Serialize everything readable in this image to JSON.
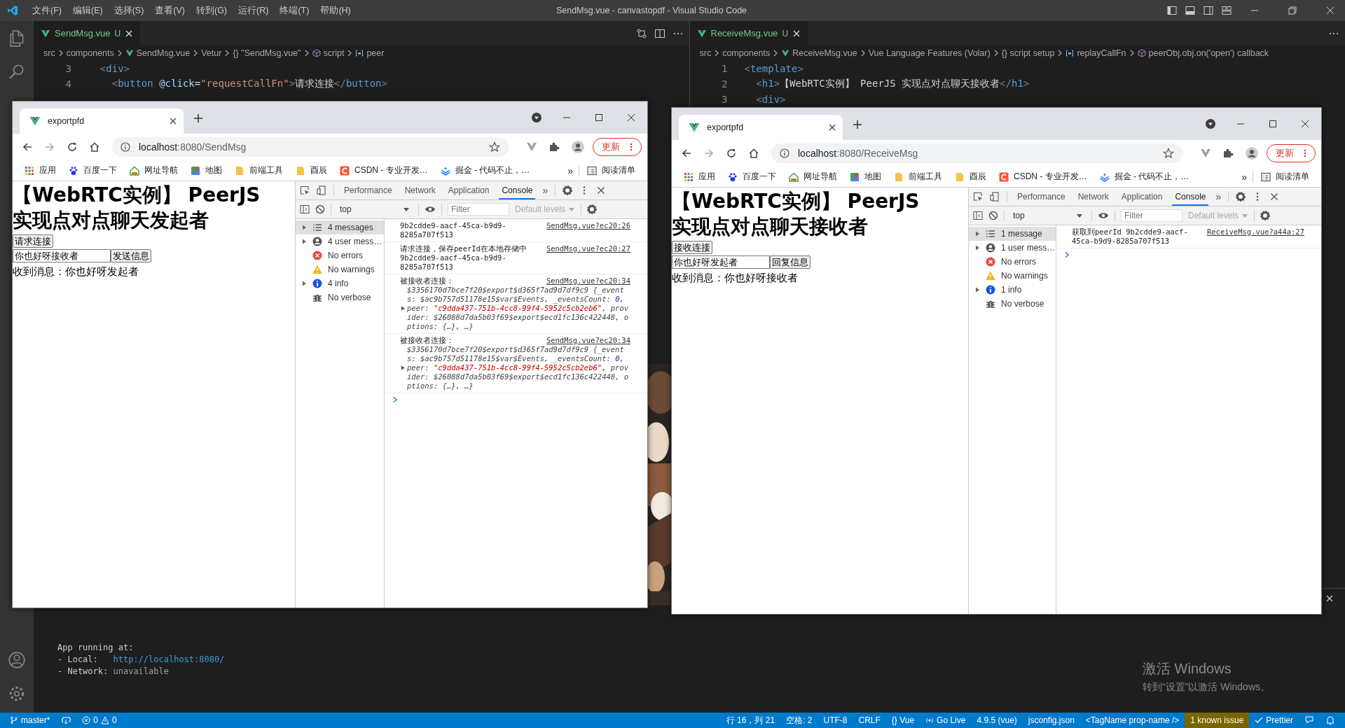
{
  "vscode": {
    "menu": [
      "文件(F)",
      "编辑(E)",
      "选择(S)",
      "查看(V)",
      "转到(G)",
      "运行(R)",
      "终端(T)",
      "帮助(H)"
    ],
    "title": "SendMsg.vue - canvastopdf - Visual Studio Code",
    "editors": [
      {
        "tab": {
          "label": "SendMsg.vue",
          "status": "U",
          "selected": true
        },
        "breadcrumbs": [
          {
            "kind": "text",
            "label": "src"
          },
          {
            "kind": "text",
            "label": "components"
          },
          {
            "kind": "vue",
            "label": "SendMsg.vue"
          },
          {
            "kind": "text",
            "label": "Vetur"
          },
          {
            "kind": "text",
            "label": "{} \"SendMsg.vue\""
          },
          {
            "kind": "cube",
            "label": "script"
          },
          {
            "kind": "var",
            "label": "peer"
          }
        ],
        "lines": [
          {
            "number": "3",
            "tokens": [
              {
                "kind": "bracket",
                "text": "  <"
              },
              {
                "kind": "tag",
                "text": "div"
              },
              {
                "kind": "bracket",
                "text": ">"
              }
            ]
          },
          {
            "number": "4",
            "tokens": [
              {
                "kind": "bracket",
                "text": "    <"
              },
              {
                "kind": "tag",
                "text": "button"
              },
              {
                "kind": "attr",
                "text": " @click"
              },
              {
                "kind": "text",
                "text": "="
              },
              {
                "kind": "string",
                "text": "\"requestCallFn\""
              },
              {
                "kind": "bracket",
                "text": ">"
              },
              {
                "kind": "text",
                "text": "请求连接"
              },
              {
                "kind": "bracket",
                "text": "</"
              },
              {
                "kind": "tag",
                "text": "button"
              },
              {
                "kind": "bracket",
                "text": ">"
              }
            ]
          }
        ]
      },
      {
        "tab": {
          "label": "ReceiveMsg.vue",
          "status": "U",
          "selected": true
        },
        "breadcrumbs": [
          {
            "kind": "text",
            "label": "src"
          },
          {
            "kind": "text",
            "label": "components"
          },
          {
            "kind": "vue",
            "label": "ReceiveMsg.vue"
          },
          {
            "kind": "text",
            "label": "Vue Language Features (Volar)"
          },
          {
            "kind": "text",
            "label": "{} script setup"
          },
          {
            "kind": "var",
            "label": "replayCallFn"
          },
          {
            "kind": "cube",
            "label": "peerObj.obj.on('open') callback"
          }
        ],
        "lines": [
          {
            "number": "1",
            "tokens": [
              {
                "kind": "bracket",
                "text": "<"
              },
              {
                "kind": "tag",
                "text": "template"
              },
              {
                "kind": "bracket",
                "text": ">"
              }
            ]
          },
          {
            "number": "2",
            "tokens": [
              {
                "kind": "bracket",
                "text": "  <"
              },
              {
                "kind": "tag",
                "text": "h1"
              },
              {
                "kind": "bracket",
                "text": ">"
              },
              {
                "kind": "text",
                "text": "【WebRTC实例】 PeerJS 实现点对点聊天接收者"
              },
              {
                "kind": "bracket",
                "text": "</"
              },
              {
                "kind": "tag",
                "text": "h1"
              },
              {
                "kind": "bracket",
                "text": ">"
              }
            ]
          },
          {
            "number": "3",
            "tokens": [
              {
                "kind": "bracket",
                "text": "  <"
              },
              {
                "kind": "tag",
                "text": "div"
              },
              {
                "kind": "bracket",
                "text": ">"
              }
            ]
          }
        ]
      }
    ],
    "terminal": [
      [
        {
          "kind": "plain",
          "text": "App running at:"
        }
      ],
      [
        {
          "kind": "plain",
          "text": "- Local:   "
        },
        {
          "kind": "link",
          "text": "http://localhost:8080/"
        }
      ],
      [
        {
          "kind": "plain",
          "text": "- Network: "
        },
        {
          "kind": "dim",
          "text": "unavailable"
        }
      ]
    ],
    "status_bar": {
      "left": [
        {
          "kind": "branch",
          "label": "master*"
        },
        {
          "kind": "sync"
        },
        {
          "kind": "problems",
          "errors": "0",
          "warnings": "0"
        }
      ],
      "right": [
        {
          "kind": "text",
          "label": "行 16，列 21"
        },
        {
          "kind": "text",
          "label": "空格: 2"
        },
        {
          "kind": "text",
          "label": "UTF-8"
        },
        {
          "kind": "text",
          "label": "CRLF"
        },
        {
          "kind": "text",
          "label": "{} Vue"
        },
        {
          "kind": "golive",
          "label": "Go Live"
        },
        {
          "kind": "text",
          "label": "4.9.5 (vue)"
        },
        {
          "kind": "text",
          "label": "jsconfig.json"
        },
        {
          "kind": "text",
          "label": "<TagName prop-name />"
        },
        {
          "kind": "issue",
          "label": "1 known issue"
        },
        {
          "kind": "check",
          "label": "Prettier"
        },
        {
          "kind": "feedback"
        },
        {
          "kind": "bell"
        }
      ]
    }
  },
  "browsers": [
    {
      "tab_title": "exportpfd",
      "url": {
        "host": "localhost",
        "path": ":8080/SendMsg"
      },
      "update_label": "更新",
      "bookmarks": [
        {
          "kind": "apps",
          "label": "应用"
        },
        {
          "kind": "paw",
          "label": "百度一下"
        },
        {
          "kind": "house",
          "label": "网址导航"
        },
        {
          "kind": "map",
          "label": "地图"
        },
        {
          "kind": "folder",
          "label": "前端工具"
        },
        {
          "kind": "folder",
          "label": "酉辰"
        },
        {
          "kind": "csdn",
          "label": "CSDN - 专业开发…"
        },
        {
          "kind": "juejin",
          "label": "掘金 - 代码不止，…"
        }
      ],
      "bookmarks_more": "»",
      "reading_list": "阅读清单",
      "page": {
        "heading": "【WebRTC实例】 PeerJS 实现点对点聊天发起者",
        "connect_button": "请求连接",
        "message_input": "你也好呀接收者",
        "send_button": "发送信息",
        "received": "收到消息：你也好呀发起者"
      },
      "devtools": {
        "tabs": [
          {
            "label": "Performance",
            "selected": false
          },
          {
            "label": "Network",
            "selected": false
          },
          {
            "label": "Application",
            "selected": false
          },
          {
            "label": "Console",
            "selected": true
          }
        ],
        "more": "»",
        "context": "top",
        "filter_placeholder": "Filter",
        "levels": "Default levels",
        "sidebar": [
          {
            "kind": "list",
            "label": "4 messages",
            "expandable": true,
            "selected": true
          },
          {
            "kind": "user",
            "label": "4 user mess…",
            "expandable": true,
            "selected": false
          },
          {
            "kind": "error",
            "label": "No errors",
            "expandable": false,
            "selected": false
          },
          {
            "kind": "warning",
            "label": "No warnings",
            "expandable": false,
            "selected": false
          },
          {
            "kind": "info",
            "label": "4 info",
            "expandable": true,
            "selected": false
          },
          {
            "kind": "verbose",
            "label": "No verbose",
            "expandable": false,
            "selected": false
          }
        ],
        "messages": [
          {
            "text": "9b2cdde9-aacf-45ca-b9d9-8285a707f513",
            "source": "SendMsg.vue?ec20:26"
          },
          {
            "text": "请求连接，保存peerId在本地存储中 9b2cdde9-aacf-45ca-b9d9-8285a707f513",
            "source": "SendMsg.vue?ec20:27"
          },
          {
            "text": "被接收者连接：",
            "source": "SendMsg.vue?ec20:34",
            "object": [
              {
                "kind": "plain",
                "text": "$3356170d7bce7f20$export$d365f7ad9d7df9c9 {_events: $ac9b757d51178e15$var$Events, _eventsCount: "
              },
              {
                "kind": "number",
                "text": "0"
              },
              {
                "kind": "plain",
                "text": ", peer: "
              },
              {
                "kind": "string",
                "text": "\"c9dda437-751b-4cc8-99f4-5952c5cb2eb6\""
              },
              {
                "kind": "plain",
                "text": ", provider: $26088d7da5b03f69$export$ecd1fc136c422448, options: {…}, …}"
              }
            ]
          },
          {
            "text": "被接收者连接：",
            "source": "SendMsg.vue?ec20:34",
            "object": [
              {
                "kind": "plain",
                "text": "$3356170d7bce7f20$export$d365f7ad9d7df9c9 {_events: $ac9b757d51178e15$var$Events, _eventsCount: "
              },
              {
                "kind": "number",
                "text": "0"
              },
              {
                "kind": "plain",
                "text": ", peer: "
              },
              {
                "kind": "string",
                "text": "\"c9dda437-751b-4cc8-99f4-5952c5cb2eb6\""
              },
              {
                "kind": "plain",
                "text": ", provider: $26088d7da5b03f69$export$ecd1fc136c422448, options: {…}, …}"
              }
            ]
          }
        ]
      }
    },
    {
      "tab_title": "exportpfd",
      "url": {
        "host": "localhost",
        "path": ":8080/ReceiveMsg"
      },
      "update_label": "更新",
      "bookmarks": [
        {
          "kind": "apps",
          "label": "应用"
        },
        {
          "kind": "paw",
          "label": "百度一下"
        },
        {
          "kind": "house",
          "label": "网址导航"
        },
        {
          "kind": "map",
          "label": "地图"
        },
        {
          "kind": "folder",
          "label": "前端工具"
        },
        {
          "kind": "folder",
          "label": "酉辰"
        },
        {
          "kind": "csdn",
          "label": "CSDN - 专业开发…"
        },
        {
          "kind": "juejin",
          "label": "掘金 - 代码不止，…"
        }
      ],
      "bookmarks_more": "»",
      "reading_list": "阅读清单",
      "page": {
        "heading": "【WebRTC实例】 PeerJS 实现点对点聊天接收者",
        "connect_button": "接收连接",
        "message_input": "你也好呀发起者",
        "send_button": "回复信息",
        "received": "收到消息：你也好呀接收者"
      },
      "devtools": {
        "tabs": [
          {
            "label": "Performance",
            "selected": false
          },
          {
            "label": "Network",
            "selected": false
          },
          {
            "label": "Application",
            "selected": false
          },
          {
            "label": "Console",
            "selected": true
          }
        ],
        "more": "»",
        "context": "top",
        "filter_placeholder": "Filter",
        "levels": "Default levels",
        "sidebar": [
          {
            "kind": "list",
            "label": "1 message",
            "expandable": true,
            "selected": true
          },
          {
            "kind": "user",
            "label": "1 user mess…",
            "expandable": true,
            "selected": false
          },
          {
            "kind": "error",
            "label": "No errors",
            "expandable": false,
            "selected": false
          },
          {
            "kind": "warning",
            "label": "No warnings",
            "expandable": false,
            "selected": false
          },
          {
            "kind": "info",
            "label": "1 info",
            "expandable": true,
            "selected": false
          },
          {
            "kind": "verbose",
            "label": "No verbose",
            "expandable": false,
            "selected": false
          }
        ],
        "messages": [
          {
            "text": "获取到peerId 9b2cdde9-aacf-45ca-b9d9-8285a707f513",
            "source": "ReceiveMsg.vue?a44a:27"
          }
        ]
      }
    }
  ],
  "os_notice": {
    "title": "激活 Windows",
    "hint": "转到“设置”以激活 Windows。"
  }
}
